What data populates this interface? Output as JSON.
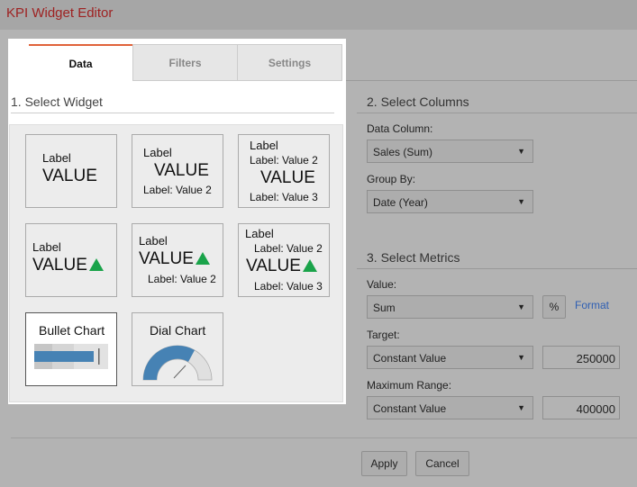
{
  "app": {
    "title": "KPI Widget Editor"
  },
  "tabs": [
    {
      "label": "Data"
    },
    {
      "label": "Filters"
    },
    {
      "label": "Settings"
    }
  ],
  "select_widget": {
    "heading": "1. Select Widget",
    "tiles": {
      "t1": {
        "label": "Label",
        "value": "VALUE"
      },
      "t2": {
        "label": "Label",
        "value": "VALUE",
        "sub": "Label: Value 2"
      },
      "t3": {
        "label": "Label",
        "sub1": "Label: Value 2",
        "value": "VALUE",
        "sub2": "Label: Value 3"
      },
      "t4": {
        "label": "Label",
        "value": "VALUE"
      },
      "t5": {
        "label": "Label",
        "value": "VALUE",
        "sub": "Label: Value 2"
      },
      "t6": {
        "label": "Label",
        "sub1": "Label: Value 2",
        "value": "VALUE",
        "sub2": "Label: Value 3"
      },
      "bullet": {
        "label": "Bullet Chart"
      },
      "dial": {
        "label": "Dial Chart"
      }
    }
  },
  "select_columns": {
    "heading": "2. Select Columns",
    "data_column_label": "Data Column:",
    "data_column": "Sales (Sum)",
    "group_by_label": "Group By:",
    "group_by": "Date (Year)"
  },
  "select_metrics": {
    "heading": "3. Select Metrics",
    "value_label": "Value:",
    "value": "Sum",
    "percent": "%",
    "format": "Format",
    "target_label": "Target:",
    "target_type": "Constant Value",
    "target_value": "250000",
    "max_label": "Maximum Range:",
    "max_type": "Constant Value",
    "max_value": "400000"
  },
  "footer": {
    "apply": "Apply",
    "cancel": "Cancel"
  },
  "colors": {
    "accent": "#e0623a",
    "title": "#9e2222",
    "up": "#1aa34a",
    "chart": "#4682b4",
    "link": "#2f5fb3"
  }
}
